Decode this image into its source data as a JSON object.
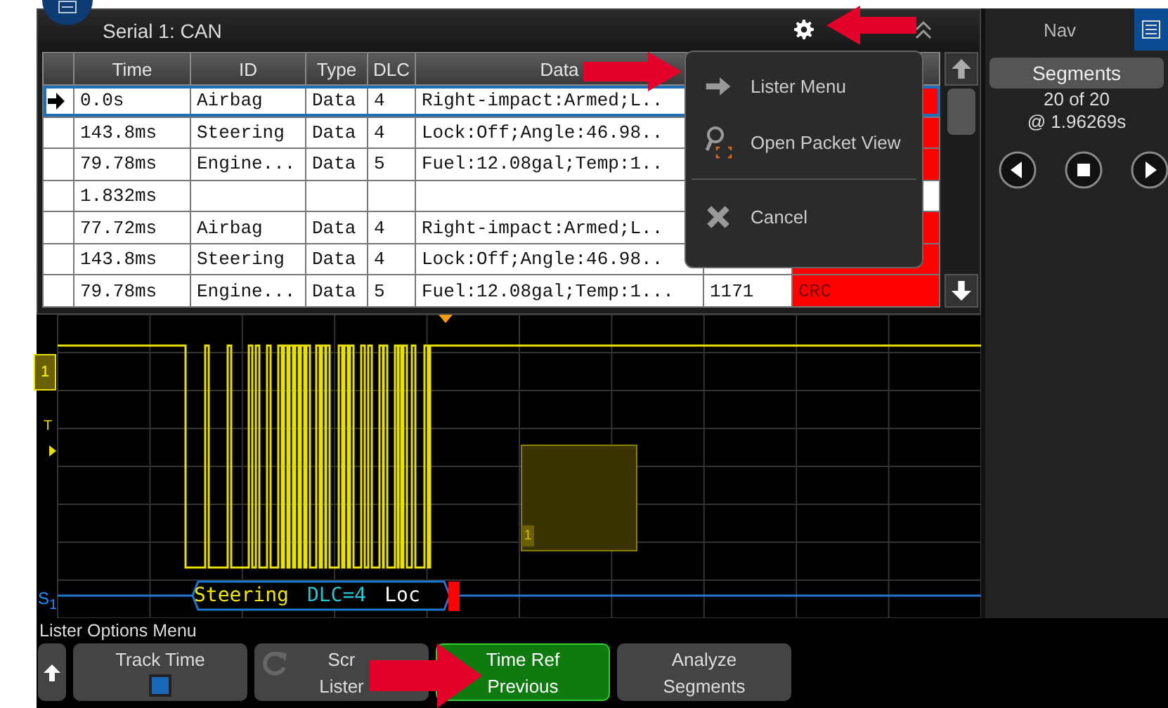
{
  "lister": {
    "title": "Serial 1: CAN",
    "columns": [
      "Time",
      "ID",
      "Type",
      "DLC",
      "Data"
    ],
    "rows": [
      {
        "selected": true,
        "time": "0.0s",
        "id": "Airbag",
        "type": "Data",
        "dlc": "4",
        "data": "Right-impact:Armed;L..",
        "error": true
      },
      {
        "selected": false,
        "time": "143.8ms",
        "id": "Steering",
        "type": "Data",
        "dlc": "4",
        "data": "Lock:Off;Angle:46.98..",
        "error": true
      },
      {
        "selected": false,
        "time": "79.78ms",
        "id": "Engine...",
        "type": "Data",
        "dlc": "5",
        "data": "Fuel:12.08gal;Temp:1..",
        "error": true
      },
      {
        "selected": false,
        "time": "1.832ms",
        "error": false
      },
      {
        "selected": false,
        "time": "77.72ms",
        "id": "Airbag",
        "type": "Data",
        "dlc": "4",
        "data": "Right-impact:Armed;L..",
        "error": true
      },
      {
        "selected": false,
        "time": "143.8ms",
        "id": "Steering",
        "type": "Data",
        "dlc": "4",
        "data": "Lock:Off;Angle:46.98..",
        "error": true
      },
      {
        "selected": false,
        "time": "79.78ms",
        "id": "Engine...",
        "type": "Data",
        "dlc": "5",
        "data": "Fuel:12.08gal;Temp:1...",
        "column_6": "1171",
        "error": true,
        "column_7": "CRC"
      }
    ]
  },
  "popup_menu": {
    "items": [
      {
        "kind": "arrow",
        "label": "Lister Menu"
      },
      {
        "kind": "packet",
        "label": "Open Packet View"
      },
      {
        "kind": "cancel",
        "label": "Cancel"
      }
    ]
  },
  "scope": {
    "channel_label": "1",
    "trigger_label": "T",
    "serial_label": "S$_{1}$",
    "segment_label": "1",
    "decode": [
      {
        "kind": "id",
        "text": "Steering"
      },
      {
        "kind": "dlc",
        "text": "DLC=4"
      },
      {
        "kind": "data",
        "text": "Loc"
      }
    ]
  },
  "nav": {
    "tabs": [
      {
        "kind": "text",
        "label": "Nav",
        "selected": false
      },
      {
        "kind": "icon",
        "selected": true
      }
    ],
    "segments_button": "Segments",
    "position": "20 of 20",
    "time": "@ 1.96269s"
  },
  "softkeys": {
    "title": "Lister Options Menu",
    "keys": [
      {
        "kind": "up",
        "selected": false
      },
      {
        "kind": "check",
        "lines": [
          "Track Time"
        ],
        "checked": false,
        "selected": false
      },
      {
        "kind": "refresh",
        "lines": [
          "Scr",
          "Lister"
        ],
        "selected": false
      },
      {
        "kind": "text",
        "lines": [
          "Time Ref",
          "Previous"
        ],
        "selected": true
      },
      {
        "kind": "text",
        "lines": [
          "Analyze",
          "Segments"
        ],
        "selected": false
      }
    ]
  }
}
